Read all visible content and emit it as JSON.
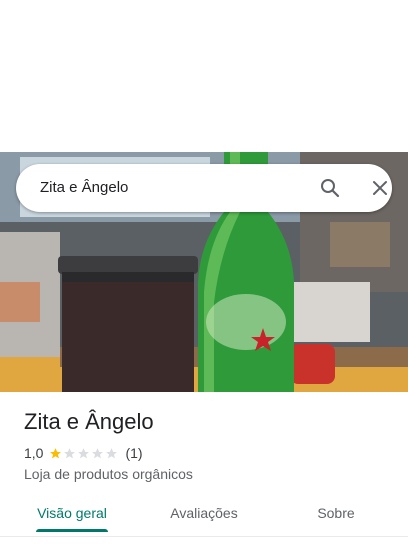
{
  "search": {
    "query": "Zita e Ângelo"
  },
  "place": {
    "name": "Zita e Ângelo",
    "rating": "1,0",
    "rating_value": 1,
    "rating_max": 5,
    "review_count": "(1)",
    "category": "Loja de produtos orgânicos"
  },
  "tabs": [
    {
      "label": "Visão geral",
      "active": true
    },
    {
      "label": "Avaliações",
      "active": false
    },
    {
      "label": "Sobre",
      "active": false
    }
  ],
  "colors": {
    "accent": "#00796b",
    "star_filled": "#fbbc04",
    "star_empty": "#dadce0"
  },
  "icons": {
    "search": "search-icon",
    "close": "close-icon"
  }
}
